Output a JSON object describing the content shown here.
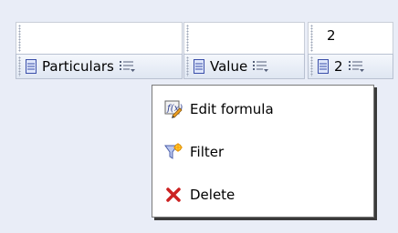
{
  "columns": [
    {
      "label": "Particulars",
      "value": ""
    },
    {
      "label": "Value",
      "value": ""
    },
    {
      "label": "2",
      "value": "2"
    }
  ],
  "context_menu": {
    "items": [
      {
        "label": "Edit formula",
        "icon": "edit-formula-icon"
      },
      {
        "label": "Filter",
        "icon": "filter-icon"
      },
      {
        "label": "Delete",
        "icon": "delete-icon"
      }
    ]
  },
  "colors": {
    "background": "#e9edf7",
    "header_gradient_top": "#f4f7fc",
    "header_gradient_bottom": "#dfe6f2",
    "delete_red": "#cc2222"
  }
}
